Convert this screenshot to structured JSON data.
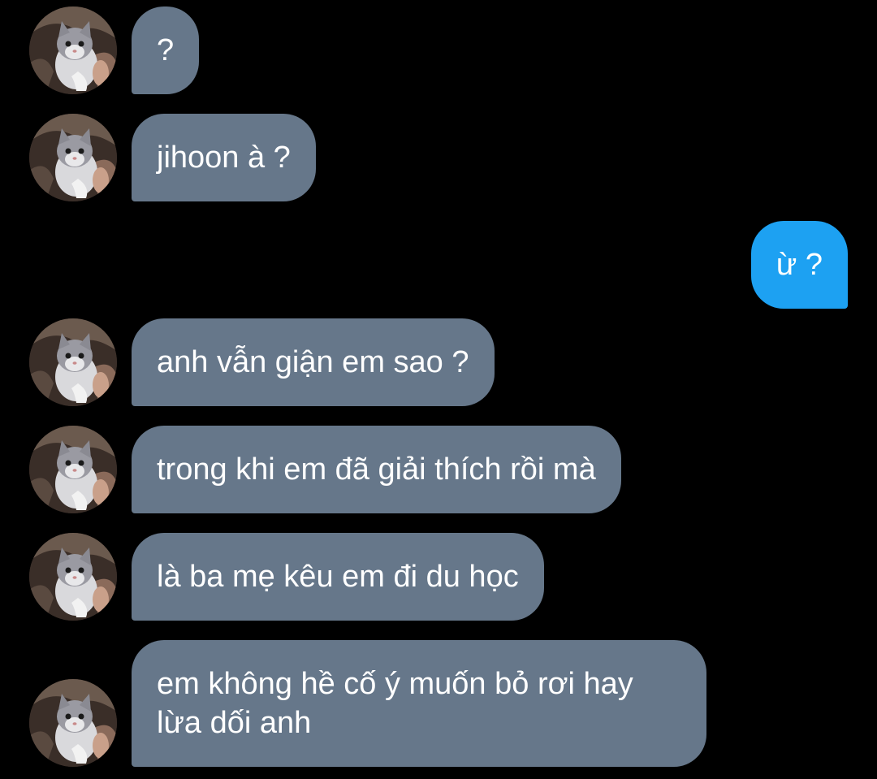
{
  "chat": {
    "messages": [
      {
        "sender": "them",
        "text": "?"
      },
      {
        "sender": "them",
        "text": "jihoon à ?"
      },
      {
        "sender": "me",
        "text": "ừ ?"
      },
      {
        "sender": "them",
        "text": "anh vẫn giận em sao ?"
      },
      {
        "sender": "them",
        "text": "trong khi em đã giải thích rồi mà"
      },
      {
        "sender": "them",
        "text": "là ba mẹ kêu em đi du học"
      },
      {
        "sender": "them",
        "lines": [
          "em không hề cố ý muốn bỏ rơi hay",
          "lừa dối anh"
        ]
      }
    ]
  },
  "avatar": {
    "icon": "cat-avatar-icon"
  },
  "colors": {
    "background": "#000000",
    "incoming_bubble": "#66778a",
    "outgoing_bubble": "#1da1f2",
    "text": "#ffffff"
  }
}
